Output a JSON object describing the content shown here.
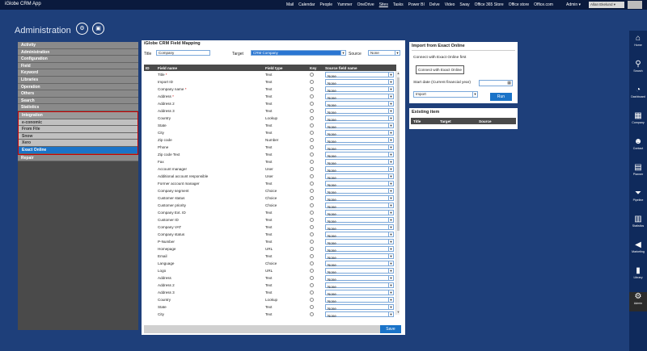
{
  "app": {
    "title": "iGlobe CRM App"
  },
  "topnav": [
    "Mail",
    "Calendar",
    "People",
    "Yammer",
    "OneDrive",
    "Sites",
    "Tasks",
    "Power BI",
    "Delve",
    "Video",
    "Sway",
    "Office 365 Store",
    "Office store",
    "Office.com"
  ],
  "topnav_active": "Sites",
  "admin_menu": "Admin ▾",
  "user": {
    "name": "Allan Ekelund ▾"
  },
  "page": {
    "title": "Administration"
  },
  "header_icons": [
    "settings-icon",
    "document-settings-icon"
  ],
  "sidebar": {
    "items": [
      {
        "label": "Activity",
        "kind": "plain"
      },
      {
        "label": "Administration",
        "kind": "plain"
      },
      {
        "label": "Configuration",
        "kind": "plain"
      },
      {
        "label": "Field",
        "kind": "plain"
      },
      {
        "label": "Keyword",
        "kind": "plain"
      },
      {
        "label": "Libraries",
        "kind": "plain"
      },
      {
        "label": "Operation",
        "kind": "plain"
      },
      {
        "label": "Others",
        "kind": "plain"
      },
      {
        "label": "Search",
        "kind": "plain"
      },
      {
        "label": "Statistics",
        "kind": "plain"
      }
    ],
    "integration": [
      {
        "label": "Integration",
        "kind": "int"
      },
      {
        "label": "e-conomic",
        "kind": "sub"
      },
      {
        "label": "From File",
        "kind": "sub"
      },
      {
        "label": "Snow",
        "kind": "sub"
      },
      {
        "label": "Xero",
        "kind": "sub"
      },
      {
        "label": "Exact Online",
        "kind": "active"
      }
    ],
    "after": [
      {
        "label": "Repair",
        "kind": "plain"
      }
    ]
  },
  "mapping": {
    "title": "iGlobe CRM Field Mapping",
    "title_label": "Title",
    "title_value": "Company",
    "target_label": "Target",
    "target_value": "CRM Company",
    "source_label": "Source",
    "source_value": "None",
    "columns": [
      "ID",
      "Field name",
      "Field type",
      "Key",
      "Source field name"
    ],
    "rows": [
      {
        "field": "Title",
        "req": true,
        "type": "Text",
        "source": "None"
      },
      {
        "field": "Import ID",
        "req": false,
        "type": "Text",
        "source": "None"
      },
      {
        "field": "Company name",
        "req": true,
        "type": "Text",
        "source": "None"
      },
      {
        "field": "Address",
        "req": true,
        "type": "Text",
        "source": "None"
      },
      {
        "field": "Address 2",
        "req": false,
        "type": "Text",
        "source": "None"
      },
      {
        "field": "Address 3",
        "req": false,
        "type": "Text",
        "source": "None"
      },
      {
        "field": "Country",
        "req": false,
        "type": "Lookup",
        "source": "None"
      },
      {
        "field": "State",
        "req": false,
        "type": "Text",
        "source": "None"
      },
      {
        "field": "City",
        "req": false,
        "type": "Text",
        "source": "None"
      },
      {
        "field": "Zip code",
        "req": false,
        "type": "Number",
        "source": "None"
      },
      {
        "field": "Phone",
        "req": false,
        "type": "Text",
        "source": "None"
      },
      {
        "field": "Zip code Text",
        "req": false,
        "type": "Text",
        "source": "None"
      },
      {
        "field": "Fax",
        "req": false,
        "type": "Text",
        "source": "None"
      },
      {
        "field": "Account manager",
        "req": false,
        "type": "User",
        "source": "None"
      },
      {
        "field": "Additional account responsible",
        "req": false,
        "type": "User",
        "source": "None"
      },
      {
        "field": "Former account manager",
        "req": false,
        "type": "Text",
        "source": "None"
      },
      {
        "field": "Company segment",
        "req": false,
        "type": "Choice",
        "source": "None"
      },
      {
        "field": "Customer status",
        "req": false,
        "type": "Choice",
        "source": "None"
      },
      {
        "field": "Customer priority",
        "req": false,
        "type": "Choice",
        "source": "None"
      },
      {
        "field": "Company Ext. ID",
        "req": false,
        "type": "Text",
        "source": "None"
      },
      {
        "field": "Customer ID",
        "req": false,
        "type": "Text",
        "source": "None"
      },
      {
        "field": "Company VAT",
        "req": false,
        "type": "Text",
        "source": "None"
      },
      {
        "field": "Company status",
        "req": false,
        "type": "Text",
        "source": "None"
      },
      {
        "field": "P-Number",
        "req": false,
        "type": "Text",
        "source": "None"
      },
      {
        "field": "Homepage",
        "req": false,
        "type": "URL",
        "source": "None"
      },
      {
        "field": "Email",
        "req": false,
        "type": "Text",
        "source": "None"
      },
      {
        "field": "Language",
        "req": false,
        "type": "Choice",
        "source": "None"
      },
      {
        "field": "Logo",
        "req": false,
        "type": "URL",
        "source": "None"
      },
      {
        "field": "Address",
        "req": false,
        "type": "Text",
        "source": "None"
      },
      {
        "field": "Address 2",
        "req": false,
        "type": "Text",
        "source": "None"
      },
      {
        "field": "Address 3",
        "req": false,
        "type": "Text",
        "source": "None"
      },
      {
        "field": "Country",
        "req": false,
        "type": "Lookup",
        "source": "None"
      },
      {
        "field": "State",
        "req": false,
        "type": "Text",
        "source": "None"
      },
      {
        "field": "City",
        "req": false,
        "type": "Text",
        "source": "None"
      }
    ],
    "save_label": "Save"
  },
  "import": {
    "title": "Import from Exact Online",
    "message": "Connect with Exact Online first",
    "connect_label": "Connect with Exact Online",
    "start_label": "Start date (Current financial year)",
    "start_value": "",
    "select_value": "Import",
    "run_label": "Run"
  },
  "existing": {
    "title": "Existing item",
    "columns": [
      "Title",
      "Target",
      "Source"
    ]
  },
  "rail": [
    {
      "icon": "⌂",
      "label": "Home",
      "name": "home-icon"
    },
    {
      "icon": "⚲",
      "label": "Search",
      "name": "search-icon"
    },
    {
      "icon": "◔",
      "label": "Dashboard",
      "name": "dashboard-icon"
    },
    {
      "icon": "▦",
      "label": "Company",
      "name": "company-icon"
    },
    {
      "icon": "☻",
      "label": "Contact",
      "name": "contact-icon"
    },
    {
      "icon": "▤",
      "label": "Planner",
      "name": "planner-icon"
    },
    {
      "icon": "⏷",
      "label": "Pipeline",
      "name": "pipeline-icon"
    },
    {
      "icon": "▥",
      "label": "Statistics",
      "name": "statistics-icon"
    },
    {
      "icon": "◀",
      "label": "Marketing",
      "name": "marketing-icon"
    },
    {
      "icon": "▮",
      "label": "Library",
      "name": "library-icon"
    },
    {
      "icon": "⚙",
      "label": "Admin",
      "name": "admin-gear-icon",
      "active": true
    }
  ],
  "colors": {
    "background": "#1e3f7a",
    "topbar": "#0a1a3d",
    "accent": "#1a73c8",
    "nav_highlight": "#cc0000"
  }
}
